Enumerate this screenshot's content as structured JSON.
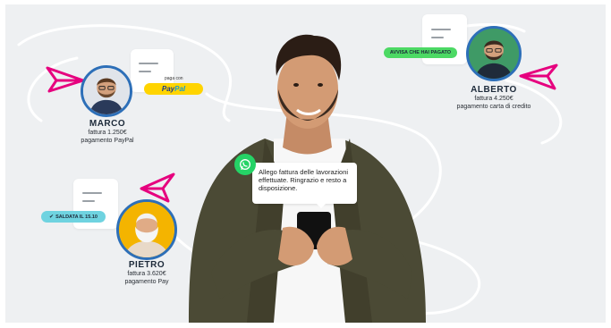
{
  "marco": {
    "name": "MARCO",
    "invoice": "fattura 1.250€",
    "payment": "pagamento PayPal",
    "paga_con": "paga con",
    "paypal_1": "Pay",
    "paypal_2": "Pal"
  },
  "alberto": {
    "name": "ALBERTO",
    "invoice": "fattura 4.250€",
    "payment": "pagamento carta di credito",
    "badge": "AVVISA CHE HAI PAGATO"
  },
  "pietro": {
    "name": "PIETRO",
    "invoice": "fattura 3.620€",
    "payment_prefix": "pagamento",
    "apple_symbol": "",
    "payment_suffix": "Pay",
    "badge_check": "✔",
    "badge": "SALDATA IL 15.10"
  },
  "message": {
    "text": "Allego fattura delle lavorazioni effettuate. Ringrazio e resto a disposizione."
  },
  "colors": {
    "accent_pink": "#e6007e",
    "avatar_ring": "#2d6fb8",
    "whatsapp": "#25d366",
    "badge_green": "#4cd964",
    "badge_teal": "#6fd3e0",
    "paypal_yellow": "#ffd400"
  }
}
